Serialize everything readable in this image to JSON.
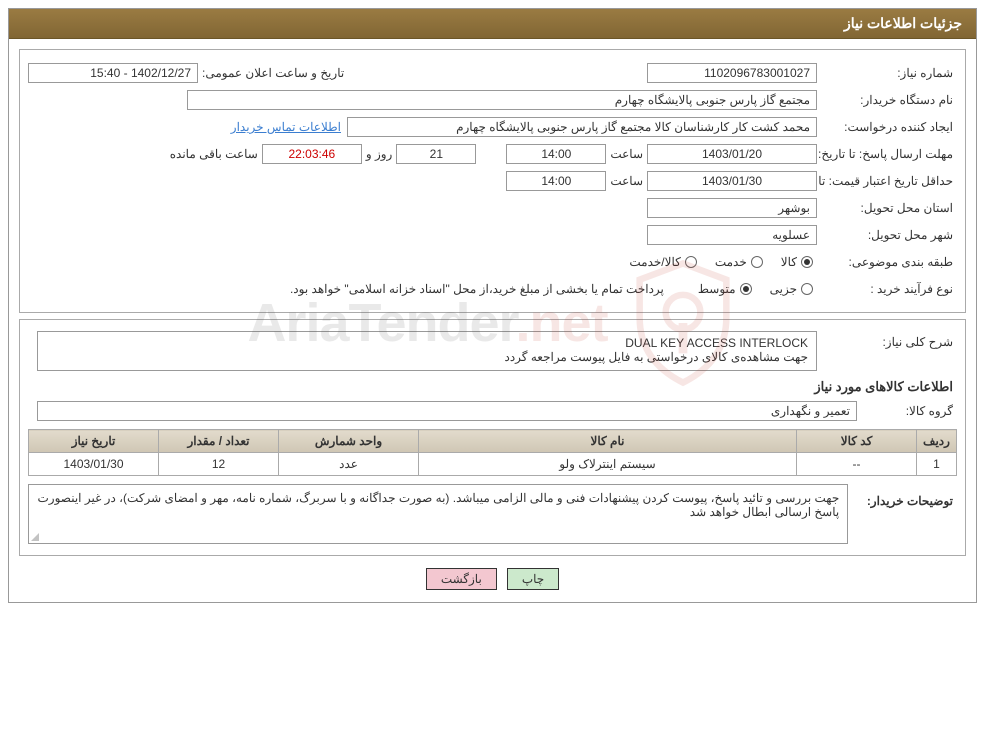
{
  "title": "جزئیات اطلاعات نیاز",
  "header": {
    "need_no_label": "شماره نیاز:",
    "need_no": "1102096783001027",
    "announce_label": "تاریخ و ساعت اعلان عمومی:",
    "announce": "1402/12/27 - 15:40"
  },
  "buyer": {
    "org_label": "نام دستگاه خریدار:",
    "org": "مجتمع گاز پارس جنوبی  پالایشگاه چهارم",
    "requester_label": "ایجاد کننده درخواست:",
    "requester": "محمد کشت کار کارشناسان کالا مجتمع گاز پارس جنوبی  پالایشگاه چهارم",
    "contact_link": "اطلاعات تماس خریدار"
  },
  "deadline": {
    "reply_until_label": "مهلت ارسال پاسخ: تا تاریخ:",
    "reply_date": "1403/01/20",
    "time_label": "ساعت",
    "reply_time": "14:00",
    "days_label": "روز و",
    "days": "21",
    "countdown": "22:03:46",
    "remaining_label": "ساعت باقی مانده",
    "min_validity_label": "حداقل تاریخ اعتبار قیمت: تا تاریخ:",
    "validity_date": "1403/01/30",
    "validity_time": "14:00"
  },
  "delivery": {
    "province_label": "استان محل تحویل:",
    "province": "بوشهر",
    "city_label": "شهر محل تحویل:",
    "city": "عسلویه"
  },
  "classification": {
    "label": "طبقه بندی موضوعی:",
    "options": {
      "goods": "کالا",
      "service": "خدمت",
      "goods_service": "کالا/خدمت"
    },
    "selected": "goods"
  },
  "purchase_process": {
    "label": "نوع فرآیند خرید :",
    "options": {
      "partial": "جزیی",
      "medium": "متوسط"
    },
    "selected": "medium",
    "note": "پرداخت تمام یا بخشی از مبلغ خرید،از محل \"اسناد خزانه اسلامی\" خواهد بود."
  },
  "description": {
    "label": "شرح کلی نیاز:",
    "line1": "DUAL KEY ACCESS INTERLOCK",
    "line2": "جهت مشاهده‌ی کالای درخواستی به فایل پیوست مراجعه گردد"
  },
  "items_section": {
    "heading": "اطلاعات کالاهای مورد نیاز",
    "group_label": "گروه کالا:",
    "group": "تعمیر و نگهداری",
    "columns": {
      "row": "ردیف",
      "code": "کد کالا",
      "name": "نام کالا",
      "unit": "واحد شمارش",
      "qty": "تعداد / مقدار",
      "need_date": "تاریخ نیاز"
    },
    "rows": [
      {
        "row": "1",
        "code": "--",
        "name": "سیستم اینترلاک ولو",
        "unit": "عدد",
        "qty": "12",
        "need_date": "1403/01/30"
      }
    ]
  },
  "buyer_notes": {
    "label": "توضیحات خریدار:",
    "text": "جهت بررسی و تائید پاسخ، پیوست کردن پیشنهادات فنی و مالی الزامی میباشد. (به صورت جداگانه و با سربرگ، شماره نامه، مهر و امضای شرکت)، در غیر اینصورت پاسخ ارسالی ابطال خواهد شد"
  },
  "buttons": {
    "print": "چاپ",
    "back": "بازگشت"
  },
  "watermark": {
    "text_a": "AriaTender",
    "text_b": ".net"
  }
}
